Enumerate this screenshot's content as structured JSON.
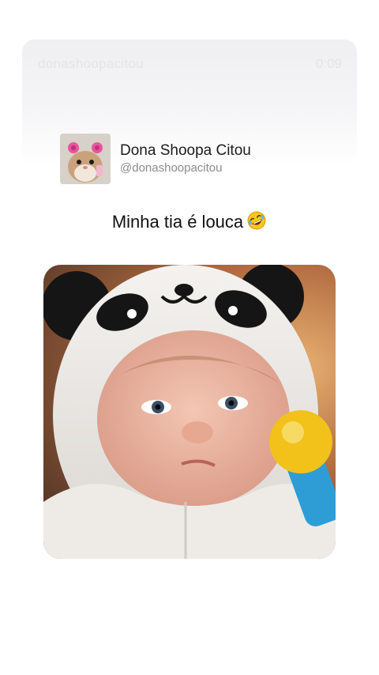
{
  "overlay": {
    "handle": "donashoopacitou",
    "timestamp": "0:09"
  },
  "post": {
    "display_name": "Dona Shoopa Citou",
    "username": "@donashoopacitou",
    "caption": "Minha tia é louca",
    "caption_emoji": "rolling-on-floor-laughing-emoji",
    "avatar": "hamster-avatar",
    "image": "baby-in-panda-hood-photo"
  }
}
